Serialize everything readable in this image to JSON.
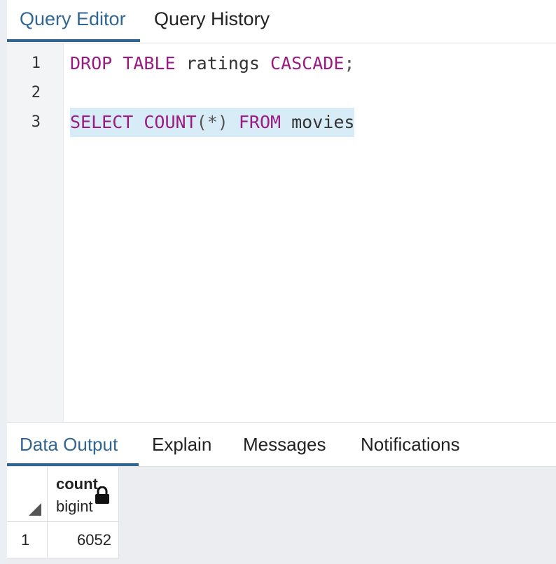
{
  "top_tabs": [
    {
      "label": "Query Editor",
      "active": true
    },
    {
      "label": "Query History",
      "active": false
    }
  ],
  "editor": {
    "line_numbers": [
      "1",
      "2",
      "3"
    ],
    "lines": [
      {
        "tokens": [
          {
            "text": "DROP",
            "type": "keyword"
          },
          {
            "text": " ",
            "type": "plain"
          },
          {
            "text": "TABLE",
            "type": "keyword"
          },
          {
            "text": " ratings ",
            "type": "plain"
          },
          {
            "text": "CASCADE",
            "type": "keyword"
          },
          {
            "text": ";",
            "type": "punct"
          }
        ]
      },
      {
        "tokens": []
      },
      {
        "tokens": [
          {
            "text": "SELECT",
            "type": "keyword"
          },
          {
            "text": " ",
            "type": "plain"
          },
          {
            "text": "COUNT",
            "type": "keyword"
          },
          {
            "text": "(*) ",
            "type": "punct"
          },
          {
            "text": "FROM",
            "type": "keyword"
          },
          {
            "text": " movies",
            "type": "plain"
          }
        ]
      }
    ]
  },
  "bottom_tabs": [
    {
      "label": "Data Output",
      "active": true
    },
    {
      "label": "Explain",
      "active": false
    },
    {
      "label": "Messages",
      "active": false
    },
    {
      "label": "Notifications",
      "active": false
    }
  ],
  "result": {
    "column": {
      "name": "count",
      "type": "bigint",
      "icon": "lock-icon"
    },
    "rows": [
      {
        "num": "1",
        "value": "6052"
      }
    ]
  },
  "colors": {
    "accent": "#326690",
    "keyword": "#9a1b82",
    "selection": "#d8ecf8"
  }
}
